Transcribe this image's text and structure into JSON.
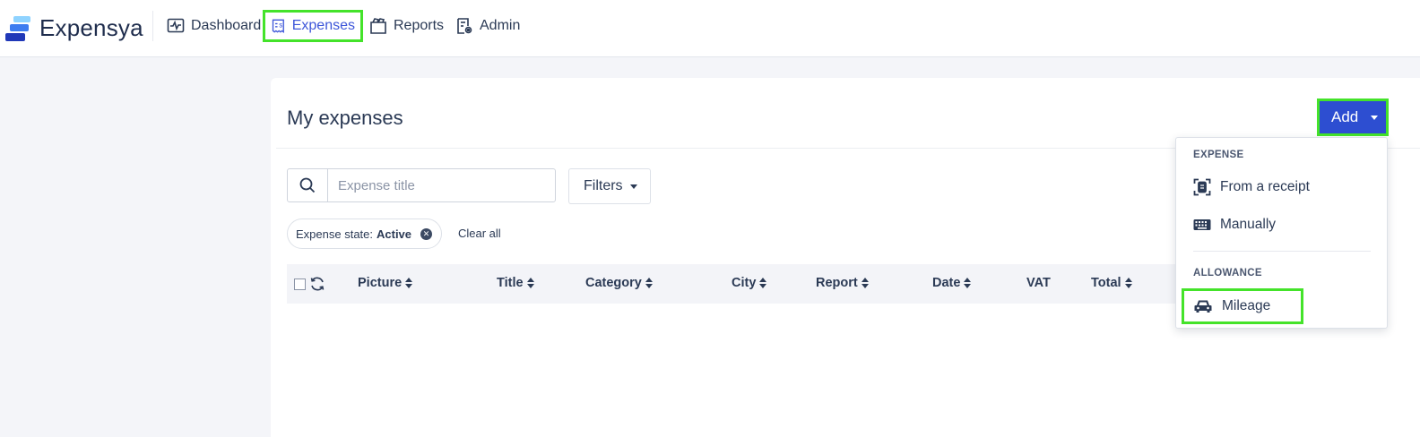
{
  "app": {
    "name": "Expensya"
  },
  "nav": {
    "items": [
      {
        "label": "Dashboard",
        "icon": "dashboard-icon",
        "active": false
      },
      {
        "label": "Expenses",
        "icon": "expenses-icon",
        "active": true
      },
      {
        "label": "Reports",
        "icon": "reports-icon",
        "active": false
      },
      {
        "label": "Admin",
        "icon": "admin-icon",
        "active": false
      }
    ]
  },
  "page": {
    "title": "My expenses",
    "add_label": "Add",
    "search_placeholder": "Expense title",
    "filters_label": "Filters",
    "active_filter": {
      "key": "Expense state:",
      "value": "Active"
    },
    "clear_all_label": "Clear all"
  },
  "table": {
    "columns": [
      {
        "label": "Picture",
        "sortable": true
      },
      {
        "label": "Title",
        "sortable": true
      },
      {
        "label": "Category",
        "sortable": true
      },
      {
        "label": "City",
        "sortable": true
      },
      {
        "label": "Report",
        "sortable": true
      },
      {
        "label": "Date",
        "sortable": true
      },
      {
        "label": "VAT",
        "sortable": false
      },
      {
        "label": "Total",
        "sortable": true
      }
    ]
  },
  "add_menu": {
    "expense_section": "EXPENSE",
    "from_receipt": "From a receipt",
    "manually": "Manually",
    "allowance_section": "ALLOWANCE",
    "mileage": "Mileage"
  },
  "colors": {
    "accent": "#2d4ed1",
    "active_nav": "#3d56d9",
    "highlight": "#44e32a",
    "text": "#2b3a55"
  }
}
